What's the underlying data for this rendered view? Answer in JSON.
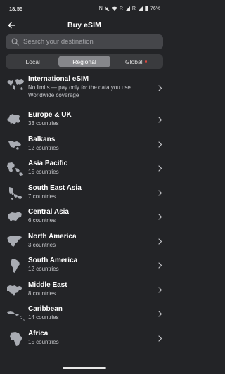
{
  "status": {
    "time": "18:55",
    "nfc": "N",
    "battery": "76%"
  },
  "header": {
    "title": "Buy eSIM"
  },
  "search": {
    "placeholder": "Search your destination"
  },
  "tabs": [
    {
      "label": "Local",
      "active": false
    },
    {
      "label": "Regional",
      "active": true
    },
    {
      "label": "Global",
      "active": false
    }
  ],
  "regions": [
    {
      "name": "International eSIM",
      "sub": "No limits — pay only for the data you use.",
      "sub2": "Worldwide coverage",
      "icon": "world-map-icon"
    },
    {
      "name": "Europe & UK",
      "sub": "33 countries",
      "icon": "europe-map-icon"
    },
    {
      "name": "Balkans",
      "sub": "12 countries",
      "icon": "balkans-map-icon"
    },
    {
      "name": "Asia Pacific",
      "sub": "15 countries",
      "icon": "asia-pacific-map-icon"
    },
    {
      "name": "South East Asia",
      "sub": "7 countries",
      "icon": "south-east-asia-map-icon"
    },
    {
      "name": "Central Asia",
      "sub": "6 countries",
      "icon": "central-asia-map-icon"
    },
    {
      "name": "North America",
      "sub": "3 countries",
      "icon": "north-america-map-icon"
    },
    {
      "name": "South America",
      "sub": "12 countries",
      "icon": "south-america-map-icon"
    },
    {
      "name": "Middle East",
      "sub": "8 countries",
      "icon": "middle-east-map-icon"
    },
    {
      "name": "Caribbean",
      "sub": "14 countries",
      "icon": "caribbean-map-icon"
    },
    {
      "name": "Africa",
      "sub": "15 countries",
      "icon": "africa-map-icon"
    }
  ],
  "colors": {
    "background": "#232427",
    "search_bg": "#45464a",
    "active_tab": "#86878b",
    "map_icon": "#a9acb3",
    "global_dot": "#e0483e"
  }
}
